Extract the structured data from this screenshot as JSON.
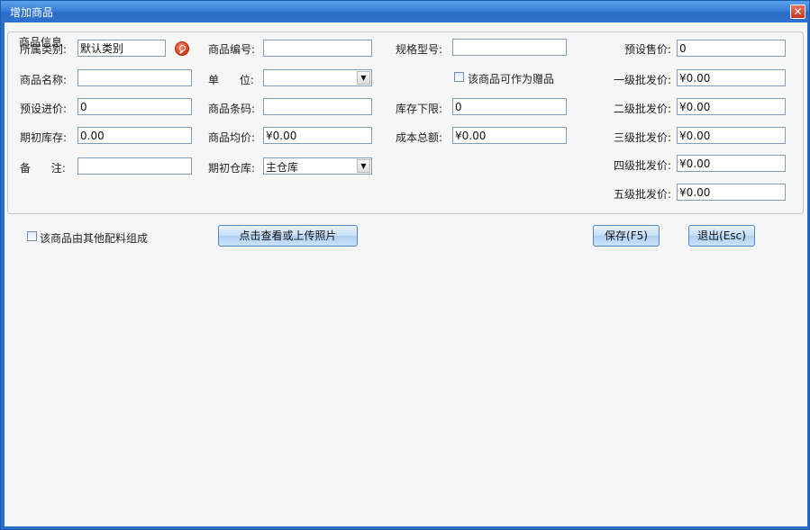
{
  "window": {
    "title": "增加商品",
    "close_glyph": "✕"
  },
  "group": {
    "title": "商品信息"
  },
  "fields": {
    "category": {
      "label": "所属类别:",
      "value": "默认类别"
    },
    "name": {
      "label": "商品名称:",
      "value": ""
    },
    "preset_buy": {
      "label": "预设进价:",
      "value": "0"
    },
    "init_stock": {
      "label": "期初库存:",
      "value": "0.00"
    },
    "remark": {
      "label": "备      注:",
      "value": ""
    },
    "code": {
      "label": "商品编号:",
      "value": ""
    },
    "unit": {
      "label": "单      位:",
      "value": ""
    },
    "barcode": {
      "label": "商品条码:",
      "value": ""
    },
    "avg_price": {
      "label": "商品均价:",
      "value": "¥0.00"
    },
    "warehouse": {
      "label": "期初仓库:",
      "value": "主仓库"
    },
    "spec": {
      "label": "规格型号:",
      "value": ""
    },
    "gift_checkbox": {
      "label": "该商品可作为赠品",
      "checked": false
    },
    "stock_min": {
      "label": "库存下限:",
      "value": "0"
    },
    "cost_total": {
      "label": "成本总额:",
      "value": "¥0.00"
    },
    "preset_sale": {
      "label": "预设售价:",
      "value": "0"
    },
    "wholesale1": {
      "label": "一级批发价:",
      "value": "¥0.00"
    },
    "wholesale2": {
      "label": "二级批发价:",
      "value": "¥0.00"
    },
    "wholesale3": {
      "label": "三级批发价:",
      "value": "¥0.00"
    },
    "wholesale4": {
      "label": "四级批发价:",
      "value": "¥0.00"
    },
    "wholesale5": {
      "label": "五级批发价:",
      "value": "¥0.00"
    }
  },
  "compose_checkbox": {
    "label": "该商品由其他配料组成",
    "checked": false
  },
  "buttons": {
    "photo": "点击查看或上传照片",
    "save": "保存(F5)",
    "exit": "退出(Esc)"
  }
}
